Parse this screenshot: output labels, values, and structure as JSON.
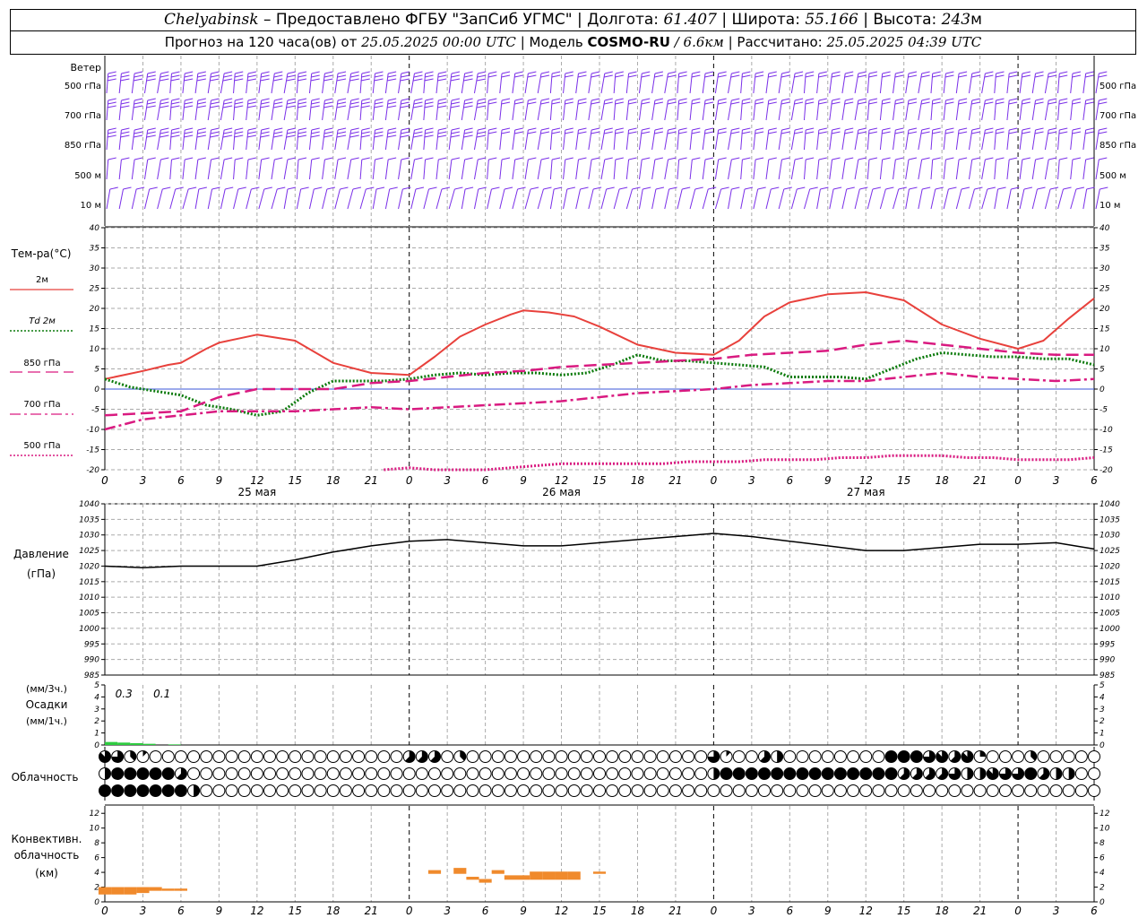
{
  "header": {
    "city": "Chelyabinsk",
    "provider": "– Предоставлено ФГБУ \"ЗапСиб УГМС\"",
    "lon_label": "Долгота:",
    "lon": "61.407",
    "lat_label": "Широта:",
    "lat": "55.166",
    "alt_label": "Высота:",
    "alt": "243",
    "alt_unit": "м",
    "forecast_label": "Прогноз на 120 часа(ов) от",
    "forecast_date": "25.05.2025 00:00 UTC",
    "model_label": "Модель",
    "model": "COSMO-RU",
    "resolution": "/ 6.6км",
    "computed_label": "Рассчитано:",
    "computed_date": "25.05.2025 04:39 UTC"
  },
  "time_axis": {
    "hour_labels": [
      "0",
      "3",
      "6",
      "9",
      "12",
      "15",
      "18",
      "21",
      "0",
      "3",
      "6",
      "9",
      "12",
      "15",
      "18",
      "21",
      "0",
      "3",
      "6",
      "9",
      "12",
      "15",
      "18",
      "21",
      "0",
      "3",
      "6"
    ],
    "day_labels": [
      {
        "text": "25 мая",
        "hour": 12
      },
      {
        "text": "26 мая",
        "hour": 36
      },
      {
        "text": "27 мая",
        "hour": 60
      }
    ]
  },
  "wind_panel": {
    "title": "Ветер",
    "levels": [
      "500 гПа",
      "700 гПа",
      "850 гПа",
      "500 м",
      "10  м"
    ],
    "colors": [
      "#7a2fe8",
      "#7a2fe8",
      "#7a2fe8",
      "#7a2fe8",
      "#7a2fe8"
    ]
  },
  "temp_panel": {
    "title": "Тем-ра(°C)",
    "legend": [
      {
        "label": "2м",
        "color": "#e8413c"
      },
      {
        "label": "Td  2м",
        "color": "#0b7a0b"
      },
      {
        "label": "850 гПа",
        "color": "#d91a80"
      },
      {
        "label": "700 гПа",
        "color": "#d91a80"
      },
      {
        "label": "500 гПа",
        "color": "#d91a80"
      }
    ],
    "yticks": [
      "-20",
      "-15",
      "-10",
      "-5",
      "0",
      "5",
      "10",
      "15",
      "20",
      "25",
      "30",
      "35",
      "40"
    ]
  },
  "pressure_panel": {
    "title": "Давление",
    "unit": "(гПа)",
    "yticks": [
      "985",
      "990",
      "995",
      "1000",
      "1005",
      "1010",
      "1015",
      "1020",
      "1025",
      "1030",
      "1035",
      "1040"
    ]
  },
  "precip_panel": {
    "unit_top": "(мм/3ч.)",
    "title": "Осадки",
    "unit_bottom": "(мм/1ч.)",
    "yticks": [
      "0",
      "1",
      "2",
      "3",
      "4",
      "5"
    ],
    "annotations": [
      {
        "text": "0.3",
        "hour": 1.5
      },
      {
        "text": "0.1",
        "hour": 4.5
      }
    ]
  },
  "cloud_panel": {
    "title": "Облачность"
  },
  "conv_panel": {
    "title_1": "Конвективн.",
    "title_2": "облачность",
    "unit": "(км)",
    "yticks": [
      "0",
      "2",
      "4",
      "6",
      "8",
      "10",
      "12"
    ]
  },
  "chart_data": [
    {
      "type": "line",
      "name": "temperature",
      "x_unit": "hours since 25.05.2025 00 UTC",
      "ylim": [
        -20,
        40
      ],
      "series": [
        {
          "name": "2м",
          "color": "#e8413c",
          "style": "solid",
          "x": [
            0,
            3,
            5,
            6,
            8,
            9,
            12,
            15,
            18,
            21,
            24,
            26,
            28,
            30,
            32,
            33,
            35,
            37,
            39,
            42,
            45,
            48,
            50,
            52,
            54,
            57,
            60,
            63,
            66,
            69,
            72,
            74,
            76,
            78
          ],
          "values": [
            2.5,
            4.5,
            6,
            6.5,
            10,
            11.5,
            13.5,
            12,
            6.5,
            4,
            3.5,
            8,
            13,
            16,
            18.5,
            19.5,
            19,
            18,
            15.5,
            11,
            9,
            8.5,
            12,
            18,
            21.5,
            23.5,
            24,
            22,
            16,
            12.5,
            10,
            12,
            17.5,
            22.5
          ]
        },
        {
          "name": "Td 2м",
          "color": "#0b7a0b",
          "style": "dotted",
          "x": [
            0,
            2,
            4,
            6,
            8,
            10,
            12,
            14,
            16,
            18,
            20,
            22,
            24,
            26,
            28,
            30,
            32,
            34,
            36,
            38,
            40,
            42,
            44,
            46,
            48,
            50,
            52,
            54,
            56,
            58,
            60,
            62,
            64,
            66,
            68,
            70,
            72,
            74,
            76,
            78
          ],
          "values": [
            2.5,
            0.5,
            -0.5,
            -1.5,
            -4,
            -5,
            -6.5,
            -5.5,
            -1,
            2,
            2,
            2,
            2.5,
            3.5,
            4,
            3.5,
            4,
            4,
            3.5,
            4,
            6,
            8.5,
            7,
            7,
            6.5,
            6,
            5.5,
            3,
            3,
            3,
            2.5,
            5,
            7.5,
            9,
            8.5,
            8,
            8,
            7.5,
            7.5,
            6
          ]
        },
        {
          "name": "850 гПа",
          "color": "#d91a80",
          "style": "dashed",
          "x": [
            0,
            3,
            6,
            9,
            12,
            15,
            18,
            21,
            24,
            27,
            30,
            33,
            36,
            39,
            42,
            45,
            48,
            51,
            54,
            57,
            60,
            63,
            66,
            69,
            72,
            75,
            78
          ],
          "values": [
            -6.5,
            -6,
            -5.5,
            -2,
            0,
            0,
            0,
            1.5,
            2,
            3,
            4,
            4.5,
            5.5,
            6,
            6.5,
            7,
            7.5,
            8.5,
            9,
            9.5,
            11,
            12,
            11,
            10,
            9,
            8.5,
            8.5
          ]
        },
        {
          "name": "700 гПа",
          "color": "#d91a80",
          "style": "dashdot",
          "x": [
            0,
            3,
            6,
            9,
            12,
            15,
            18,
            21,
            24,
            27,
            30,
            33,
            36,
            39,
            42,
            45,
            48,
            51,
            54,
            57,
            60,
            63,
            66,
            69,
            72,
            75,
            78
          ],
          "values": [
            -10,
            -7.5,
            -6.5,
            -5.5,
            -5.5,
            -5.5,
            -5,
            -4.5,
            -5,
            -4.5,
            -4,
            -3.5,
            -3,
            -2,
            -1,
            -0.5,
            0,
            1,
            1.5,
            2,
            2,
            3,
            4,
            3,
            2.5,
            2,
            2.5
          ]
        },
        {
          "name": "500 гПа",
          "color": "#d91a80",
          "style": "dotted",
          "x": [
            22,
            24,
            26,
            28,
            30,
            32,
            34,
            36,
            38,
            40,
            42,
            44,
            46,
            48,
            50,
            52,
            54,
            56,
            58,
            60,
            62,
            64,
            66,
            68,
            70,
            72,
            74,
            76,
            78
          ],
          "values": [
            -20,
            -19.5,
            -20,
            -20,
            -20,
            -19.5,
            -19,
            -18.5,
            -18.5,
            -18.5,
            -18.5,
            -18.5,
            -18,
            -18,
            -18,
            -17.5,
            -17.5,
            -17.5,
            -17,
            -17,
            -16.5,
            -16.5,
            -16.5,
            -17,
            -17,
            -17.5,
            -17.5,
            -17.5,
            -17
          ]
        }
      ]
    },
    {
      "type": "line",
      "name": "pressure",
      "ylim": [
        985,
        1040
      ],
      "series": [
        {
          "name": "",
          "color": "#000000",
          "style": "solid",
          "x": [
            0,
            3,
            6,
            9,
            12,
            15,
            18,
            21,
            24,
            27,
            30,
            33,
            36,
            39,
            42,
            45,
            48,
            51,
            54,
            57,
            60,
            63,
            66,
            69,
            72,
            75,
            78
          ],
          "values": [
            1020,
            1019.5,
            1020,
            1020,
            1020,
            1022,
            1024.5,
            1026.5,
            1028,
            1028.5,
            1027.5,
            1026.5,
            1026.5,
            1027.5,
            1028.5,
            1029.5,
            1030.5,
            1029.5,
            1028,
            1026.5,
            1025,
            1025,
            1026,
            1027,
            1027,
            1027.5,
            1025.5
          ]
        }
      ]
    },
    {
      "type": "bar",
      "name": "precipitation",
      "ylim": [
        0,
        5
      ],
      "x": [
        0,
        1,
        2,
        3,
        5
      ],
      "values": [
        0.25,
        0.2,
        0.15,
        0.1,
        0.05
      ],
      "color": "#2ecc40"
    },
    {
      "type": "bar",
      "name": "convective_cloud",
      "ylim": [
        0,
        12
      ],
      "bars": [
        {
          "x": 0,
          "base": 1.0,
          "top": 2.0
        },
        {
          "x": 1,
          "base": 1.0,
          "top": 2.0
        },
        {
          "x": 2,
          "base": 1.0,
          "top": 2.0
        },
        {
          "x": 3,
          "base": 1.2,
          "top": 2.0
        },
        {
          "x": 4,
          "base": 1.5,
          "top": 2.0
        },
        {
          "x": 5,
          "base": 1.5,
          "top": 1.8
        },
        {
          "x": 6,
          "base": 1.5,
          "top": 1.8
        },
        {
          "x": 26,
          "base": 3.8,
          "top": 4.3
        },
        {
          "x": 28,
          "base": 3.8,
          "top": 4.6
        },
        {
          "x": 29,
          "base": 3.0,
          "top": 3.4
        },
        {
          "x": 30,
          "base": 2.6,
          "top": 3.1
        },
        {
          "x": 31,
          "base": 3.8,
          "top": 4.3
        },
        {
          "x": 32,
          "base": 3.0,
          "top": 3.6
        },
        {
          "x": 33,
          "base": 3.0,
          "top": 3.6
        },
        {
          "x": 34,
          "base": 3.0,
          "top": 4.1
        },
        {
          "x": 35,
          "base": 3.0,
          "top": 4.1
        },
        {
          "x": 36,
          "base": 3.0,
          "top": 4.1
        },
        {
          "x": 37,
          "base": 3.0,
          "top": 4.1
        },
        {
          "x": 39,
          "base": 3.8,
          "top": 4.1
        }
      ],
      "color": "#f08a2c"
    },
    {
      "type": "table",
      "name": "cloud_cover_octas",
      "note_rows": "top row: upper cloud, middle row: mid cloud, bottom row: low cloud; values 0-8",
      "rows": [
        [
          7,
          6,
          3,
          1,
          0,
          0,
          0,
          0,
          0,
          0,
          0,
          0,
          0,
          0,
          0,
          0,
          0,
          0,
          0,
          0,
          0,
          0,
          0,
          0,
          5,
          5,
          5,
          0,
          3,
          0,
          0,
          0,
          0,
          0,
          0,
          0,
          0,
          0,
          0,
          0,
          0,
          0,
          0,
          0,
          0,
          0,
          0,
          0,
          6,
          1,
          0,
          0,
          5,
          4,
          0,
          0,
          0,
          0,
          0,
          0,
          0,
          0,
          8,
          8,
          8,
          6,
          7,
          5,
          7,
          2,
          0,
          0,
          0,
          3,
          0,
          0,
          0,
          0,
          0,
          4,
          0,
          0,
          0,
          0,
          0,
          0,
          0,
          0,
          0,
          0,
          0,
          0,
          0,
          0,
          0,
          0,
          0,
          0,
          0,
          0,
          0,
          0,
          0,
          0,
          0,
          0,
          0,
          0,
          0,
          0,
          4,
          7,
          0,
          0,
          0,
          0,
          6,
          0,
          0,
          0
        ],
        [
          4,
          8,
          8,
          8,
          8,
          8,
          5,
          0,
          0,
          0,
          0,
          0,
          0,
          0,
          0,
          0,
          0,
          0,
          0,
          0,
          0,
          0,
          0,
          0,
          0,
          0,
          0,
          0,
          0,
          0,
          0,
          0,
          0,
          0,
          0,
          0,
          0,
          0,
          0,
          0,
          0,
          0,
          0,
          0,
          0,
          0,
          0,
          0,
          4,
          8,
          8,
          8,
          8,
          8,
          8,
          8,
          8,
          8,
          8,
          8,
          8,
          8,
          8,
          5,
          5,
          5,
          5,
          6,
          4,
          4,
          7,
          6,
          6,
          8,
          5,
          4,
          4,
          0,
          0,
          0,
          0,
          0,
          0,
          0,
          0,
          0,
          0,
          0,
          0,
          0,
          0,
          0,
          0,
          0,
          0,
          0,
          0,
          0,
          0,
          0,
          0,
          0,
          0,
          0,
          0,
          0,
          0,
          0,
          0,
          0,
          0,
          0,
          0,
          0,
          0,
          0,
          0,
          0,
          0,
          0
        ],
        [
          8,
          8,
          8,
          8,
          8,
          8,
          8,
          4,
          0,
          0,
          0,
          0,
          0,
          0,
          0,
          0,
          0,
          0,
          0,
          0,
          0,
          0,
          0,
          0,
          0,
          0,
          0,
          0,
          0,
          0,
          0,
          0,
          0,
          0,
          0,
          0,
          0,
          0,
          0,
          0,
          0,
          0,
          0,
          0,
          0,
          0,
          0,
          0,
          0,
          0,
          0,
          0,
          0,
          0,
          0,
          0,
          0,
          0,
          0,
          0,
          0,
          0,
          0,
          0,
          0,
          0,
          0,
          0,
          0,
          0,
          0,
          0,
          0,
          0,
          0,
          0,
          0,
          0,
          0,
          0,
          0,
          0,
          0,
          0,
          0,
          0,
          0,
          0,
          0,
          0,
          0,
          0,
          0,
          0,
          0,
          0,
          0,
          0,
          0,
          0,
          0,
          0,
          0,
          0,
          0,
          0,
          0,
          0,
          0,
          0,
          0,
          0,
          0,
          0,
          0,
          0,
          0,
          0,
          0,
          0
        ]
      ]
    }
  ]
}
